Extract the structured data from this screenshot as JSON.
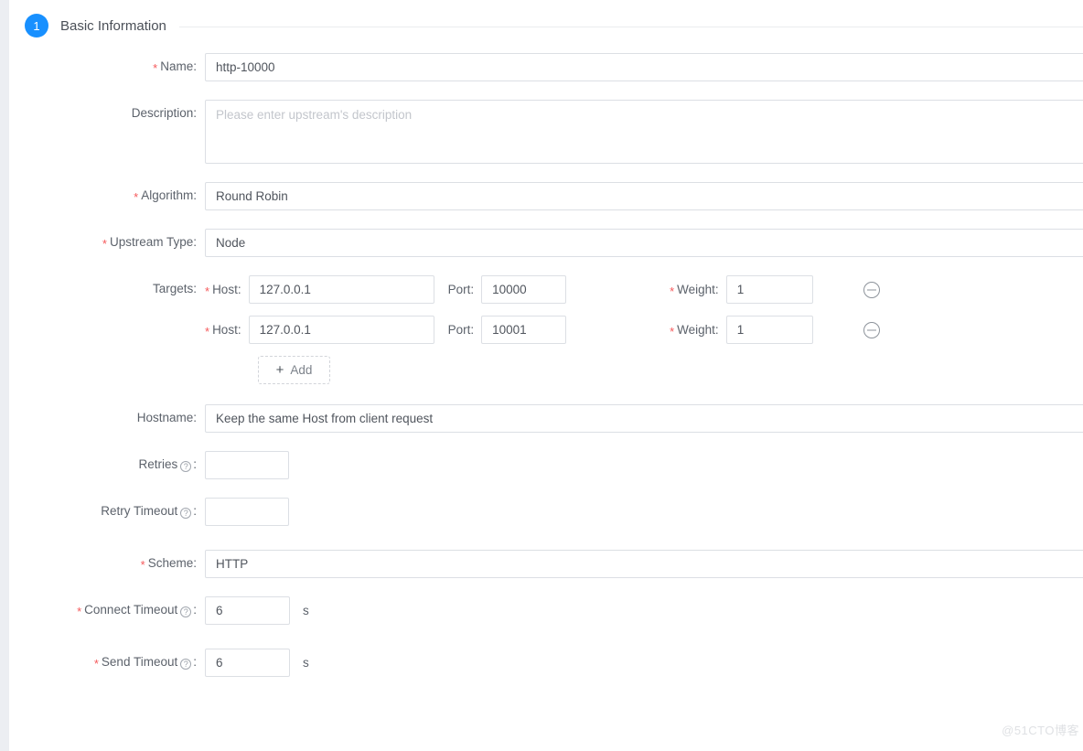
{
  "step": {
    "number": "1",
    "title": "Basic Information",
    "badge_color": "#1890ff"
  },
  "form": {
    "name": {
      "label": "Name:",
      "required": true,
      "value": "http-10000"
    },
    "description": {
      "label": "Description:",
      "required": false,
      "value": "",
      "placeholder": "Please enter upstream's description"
    },
    "algorithm": {
      "label": "Algorithm:",
      "required": true,
      "value": "Round Robin"
    },
    "upstream_type": {
      "label": "Upstream Type:",
      "required": true,
      "value": "Node"
    },
    "targets": {
      "label": "Targets:",
      "host_label": "Host:",
      "port_label": "Port:",
      "weight_label": "Weight:",
      "add_label": "Add",
      "add_icon": "plus-icon",
      "remove_icon": "minus-circle-icon",
      "rows": [
        {
          "host": "127.0.0.1",
          "port": "10000",
          "weight": "1"
        },
        {
          "host": "127.0.0.1",
          "port": "10001",
          "weight": "1"
        }
      ]
    },
    "hostname": {
      "label": "Hostname:",
      "required": false,
      "value": "Keep the same Host from client request"
    },
    "retries": {
      "label": "Retries",
      "required": false,
      "help_icon": "question-circle-icon",
      "value": ""
    },
    "retry_timeout": {
      "label": "Retry Timeout",
      "required": false,
      "help_icon": "question-circle-icon",
      "value": ""
    },
    "scheme": {
      "label": "Scheme:",
      "required": true,
      "value": "HTTP"
    },
    "connect_timeout": {
      "label": "Connect Timeout",
      "required": true,
      "help_icon": "question-circle-icon",
      "value": "6",
      "unit": "s"
    },
    "send_timeout": {
      "label": "Send Timeout",
      "required": true,
      "help_icon": "question-circle-icon",
      "value": "6",
      "unit": "s"
    }
  },
  "watermark": "@51CTO博客"
}
